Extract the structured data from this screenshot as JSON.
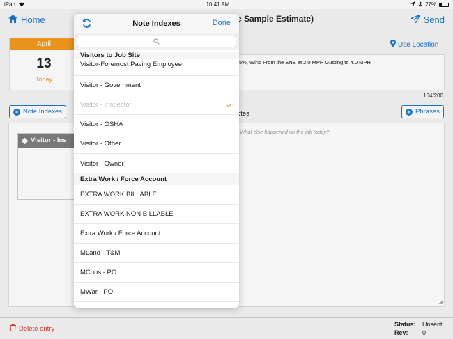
{
  "statusbar": {
    "device": "iPad",
    "time": "10:41 AM",
    "battery": "27%"
  },
  "navbar": {
    "home_label": "Home",
    "title_fragment": "e Sample Estimate)",
    "send_label": "Send"
  },
  "date": {
    "month": "April",
    "day": "13",
    "today": "Today"
  },
  "location": {
    "label": "Use Location"
  },
  "weather": {
    "text": "5%, Wind From the ENE at 2.0 MPH Gusting to 4.0 MPH",
    "count": "104/200"
  },
  "toolbar": {
    "note_indexes_label": "Note Indexes",
    "phrases_label": "Phrases"
  },
  "notes": {
    "label": "otes",
    "placeholder": "What else happened on the job today?",
    "tag_label": "Visitor - Ins"
  },
  "bottom": {
    "delete_label": "Delete entry",
    "status_label": "Status:",
    "status_value": "Unsent",
    "rev_label": "Rev:",
    "rev_value": "0"
  },
  "popover": {
    "title": "Note Indexes",
    "done_label": "Done",
    "sections": [
      {
        "heading": "Visitors to Job Site",
        "items": [
          {
            "label": "Visitor-Foremost Paving Employee"
          },
          {
            "label": "Visitor - Government"
          },
          {
            "label": "Visitor - Inspector",
            "selected": true
          },
          {
            "label": "Visitor - OSHA"
          },
          {
            "label": "Visitor - Other"
          },
          {
            "label": "Visitor - Owner"
          }
        ]
      },
      {
        "heading": "Extra Work / Force Account",
        "items": [
          {
            "label": "EXTRA WORK BILLABLE"
          },
          {
            "label": "EXTRA WORK NON BILLABLE"
          },
          {
            "label": "Extra Work / Force Account"
          },
          {
            "label": "MLand - T&M"
          },
          {
            "label": "MCons - PO"
          },
          {
            "label": "MWar - PO"
          }
        ]
      }
    ]
  },
  "colors": {
    "accent": "#1a76d2",
    "orange": "#f39a1e",
    "danger": "#d13b2e"
  }
}
